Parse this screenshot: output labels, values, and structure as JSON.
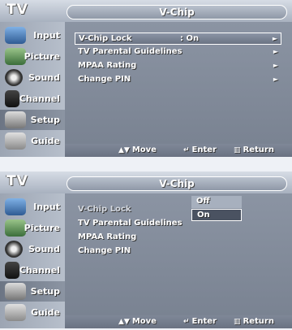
{
  "screens": [
    {
      "brand": "TV",
      "title": "V-Chip",
      "sidebar": [
        {
          "label": "Input",
          "icon": "input-icon"
        },
        {
          "label": "Picture",
          "icon": "picture-icon"
        },
        {
          "label": "Sound",
          "icon": "sound-icon"
        },
        {
          "label": "Channel",
          "icon": "channel-icon"
        },
        {
          "label": "Setup",
          "icon": "setup-icon",
          "selected": true
        },
        {
          "label": "Guide",
          "icon": "guide-icon"
        }
      ],
      "menu": [
        {
          "label": "V-Chip Lock",
          "value": ": On",
          "arrow": "►",
          "highlighted": true
        },
        {
          "label": "TV Parental Guidelines",
          "value": "",
          "arrow": "►"
        },
        {
          "label": "MPAA Rating",
          "value": "",
          "arrow": "►"
        },
        {
          "label": "Change PIN",
          "value": "",
          "arrow": "►"
        }
      ],
      "footer": {
        "move": "Move",
        "enter": "Enter",
        "return": "Return"
      }
    },
    {
      "brand": "TV",
      "title": "V-Chip",
      "sidebar": [
        {
          "label": "Input",
          "icon": "input-icon"
        },
        {
          "label": "Picture",
          "icon": "picture-icon"
        },
        {
          "label": "Sound",
          "icon": "sound-icon"
        },
        {
          "label": "Channel",
          "icon": "channel-icon"
        },
        {
          "label": "Setup",
          "icon": "setup-icon",
          "selected": true
        },
        {
          "label": "Guide",
          "icon": "guide-icon"
        }
      ],
      "menu": [
        {
          "label": "V-Chip Lock",
          "value": "",
          "arrow": "",
          "dim": true
        },
        {
          "label": "TV Parental Guidelines",
          "value": "",
          "arrow": ""
        },
        {
          "label": "MPAA Rating",
          "value": "",
          "arrow": ""
        },
        {
          "label": "Change PIN",
          "value": "",
          "arrow": ""
        }
      ],
      "dropdown": {
        "options": [
          "Off",
          "On"
        ],
        "selected": "On"
      },
      "footer": {
        "move": "Move",
        "enter": "Enter",
        "return": "Return"
      }
    }
  ],
  "colors": {
    "selected_bg": "#4a5261",
    "highlight_border": "#ffffff"
  }
}
